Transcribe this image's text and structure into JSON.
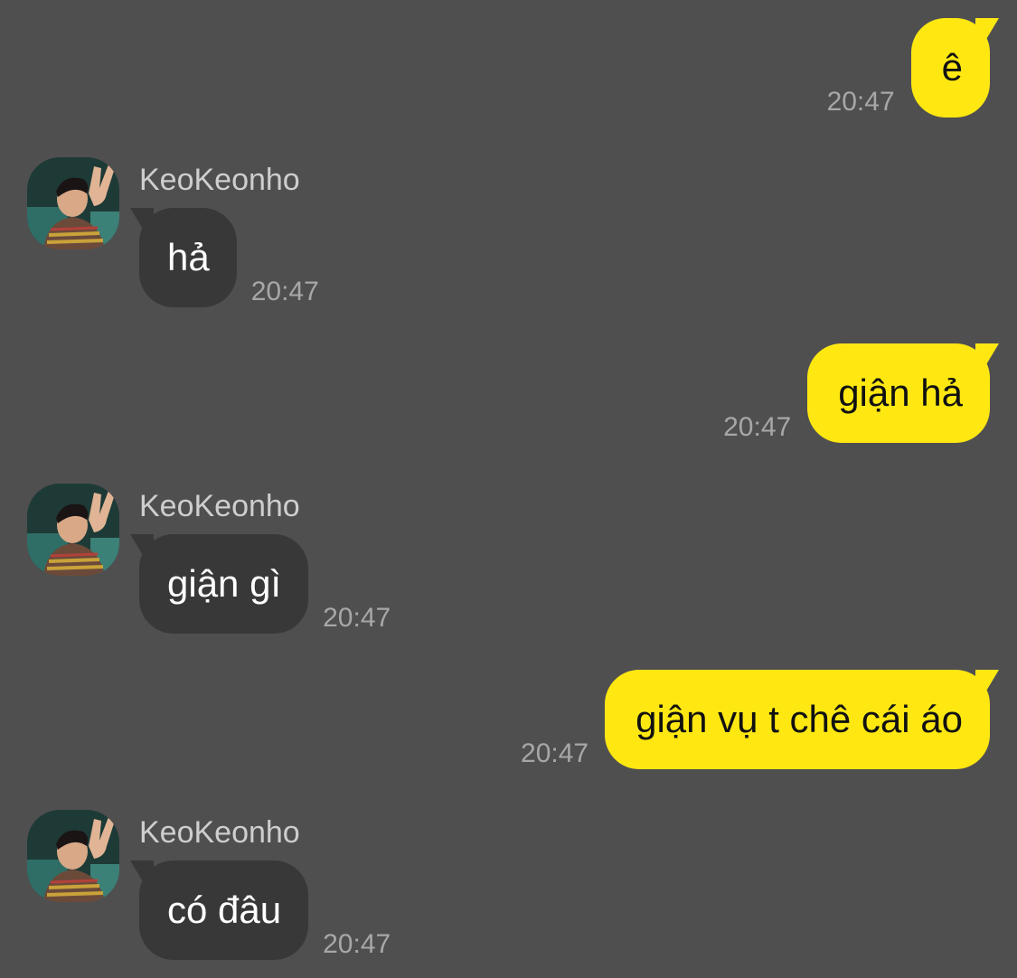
{
  "chat": {
    "contact_name": "KeoKeonho",
    "messages": [
      {
        "direction": "out",
        "text": "ê",
        "time": "20:47"
      },
      {
        "direction": "in",
        "sender": "KeoKeonho",
        "text": "hả",
        "time": "20:47"
      },
      {
        "direction": "out",
        "text": "giận hả",
        "time": "20:47"
      },
      {
        "direction": "in",
        "sender": "KeoKeonho",
        "text": "giận gì",
        "time": "20:47"
      },
      {
        "direction": "out",
        "text": "giận vụ t chê cái áo",
        "time": "20:47"
      },
      {
        "direction": "in",
        "sender": "KeoKeonho",
        "text": "có đâu",
        "time": "20:47"
      }
    ]
  },
  "colors": {
    "background": "#504f50",
    "outgoing_bubble": "#ffe812",
    "incoming_bubble": "#393839",
    "timestamp": "#a8a7a8",
    "sender_name": "#cfcecf"
  },
  "icons": {
    "avatar": "contact-avatar-photo"
  }
}
